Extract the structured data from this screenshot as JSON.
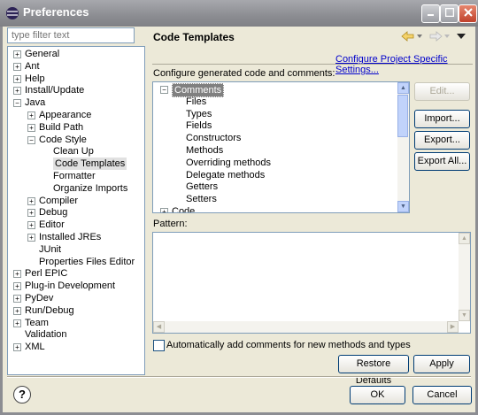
{
  "window": {
    "title": "Preferences"
  },
  "filter": {
    "placeholder": "type filter text"
  },
  "nav_tree": [
    {
      "label": "General",
      "expander": "+",
      "level": 0
    },
    {
      "label": "Ant",
      "expander": "+",
      "level": 0
    },
    {
      "label": "Help",
      "expander": "+",
      "level": 0
    },
    {
      "label": "Install/Update",
      "expander": "+",
      "level": 0
    },
    {
      "label": "Java",
      "expander": "-",
      "level": 0
    },
    {
      "label": "Appearance",
      "expander": "+",
      "level": 1
    },
    {
      "label": "Build Path",
      "expander": "+",
      "level": 1
    },
    {
      "label": "Code Style",
      "expander": "-",
      "level": 1
    },
    {
      "label": "Clean Up",
      "expander": "",
      "level": 2
    },
    {
      "label": "Code Templates",
      "expander": "",
      "level": 2,
      "selected": true
    },
    {
      "label": "Formatter",
      "expander": "",
      "level": 2
    },
    {
      "label": "Organize Imports",
      "expander": "",
      "level": 2
    },
    {
      "label": "Compiler",
      "expander": "+",
      "level": 1
    },
    {
      "label": "Debug",
      "expander": "+",
      "level": 1
    },
    {
      "label": "Editor",
      "expander": "+",
      "level": 1
    },
    {
      "label": "Installed JREs",
      "expander": "+",
      "level": 1
    },
    {
      "label": "JUnit",
      "expander": "",
      "level": 1
    },
    {
      "label": "Properties Files Editor",
      "expander": "",
      "level": 1
    },
    {
      "label": "Perl EPIC",
      "expander": "+",
      "level": 0
    },
    {
      "label": "Plug-in Development",
      "expander": "+",
      "level": 0
    },
    {
      "label": "PyDev",
      "expander": "+",
      "level": 0
    },
    {
      "label": "Run/Debug",
      "expander": "+",
      "level": 0
    },
    {
      "label": "Team",
      "expander": "+",
      "level": 0
    },
    {
      "label": "Validation",
      "expander": "",
      "level": 0
    },
    {
      "label": "XML",
      "expander": "+",
      "level": 0
    }
  ],
  "panel": {
    "title": "Code Templates",
    "project_link": "Configure Project Specific Settings...",
    "configure_label": "Configure generated code and comments:",
    "template_tree": [
      {
        "label": "Comments",
        "expander": "-",
        "level": 0,
        "selected": true
      },
      {
        "label": "Files",
        "expander": "",
        "level": 1
      },
      {
        "label": "Types",
        "expander": "",
        "level": 1
      },
      {
        "label": "Fields",
        "expander": "",
        "level": 1
      },
      {
        "label": "Constructors",
        "expander": "",
        "level": 1
      },
      {
        "label": "Methods",
        "expander": "",
        "level": 1
      },
      {
        "label": "Overriding methods",
        "expander": "",
        "level": 1
      },
      {
        "label": "Delegate methods",
        "expander": "",
        "level": 1
      },
      {
        "label": "Getters",
        "expander": "",
        "level": 1
      },
      {
        "label": "Setters",
        "expander": "",
        "level": 1
      },
      {
        "label": "Code",
        "expander": "+",
        "level": 0
      }
    ],
    "edit_button": "Edit...",
    "import_button": "Import...",
    "export_button": "Export...",
    "export_all_button": "Export All...",
    "pattern_label": "Pattern:",
    "checkbox_label": "Automatically add comments for new methods and types",
    "restore_defaults_button": "Restore Defaults",
    "apply_button": "Apply"
  },
  "footer": {
    "ok_button": "OK",
    "cancel_button": "Cancel",
    "help_glyph": "?"
  },
  "icons": {
    "back": "back-arrow-icon",
    "forward": "forward-arrow-icon",
    "menu": "view-menu-icon"
  },
  "colors": {
    "titlebar": "#8c8d92",
    "link": "#0000cc"
  }
}
